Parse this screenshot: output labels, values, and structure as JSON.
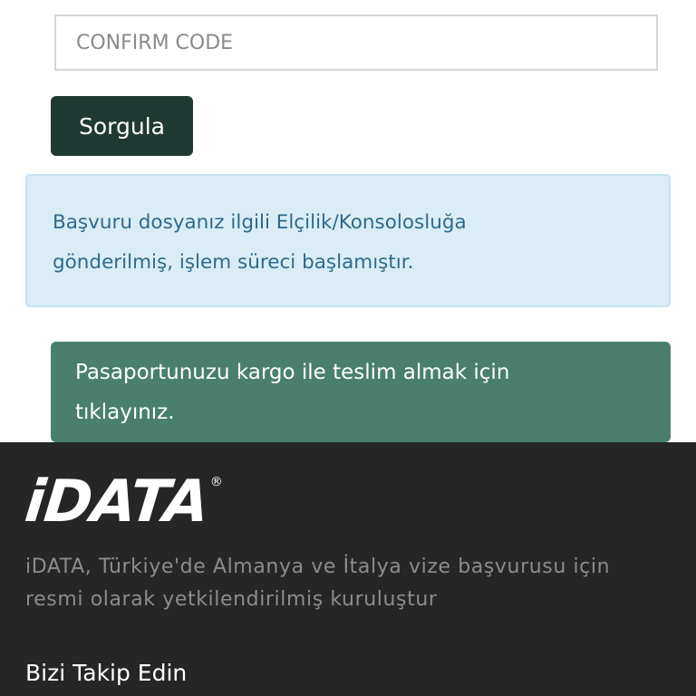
{
  "form": {
    "code_placeholder": "CONFIRM CODE",
    "code_value": "",
    "submit_label": "Sorgula"
  },
  "status_alert": {
    "line1": "Başvuru dosyanız ilgili Elçilik/Konsolosluğa",
    "line2": "gönderilmiş, işlem süreci başlamıştır."
  },
  "cargo_button": {
    "line1": "Pasaportunuzu kargo ile teslim almak için",
    "line2": "tıklayınız."
  },
  "footer": {
    "logo_text": "iDATA",
    "logo_mark": "®",
    "description_line1": "iDATA, Türkiye'de Almanya ve İtalya vize başvurusu için",
    "description_line2": "resmi olarak yetkilendirilmiş kuruluştur",
    "follow_heading": "Bizi Takip Edin"
  },
  "colors": {
    "primary_button": "#1f3a32",
    "info_background": "#daedf6",
    "info_text": "#2f6a8a",
    "cargo_button": "#4a7f6d",
    "footer_background": "#262626"
  }
}
